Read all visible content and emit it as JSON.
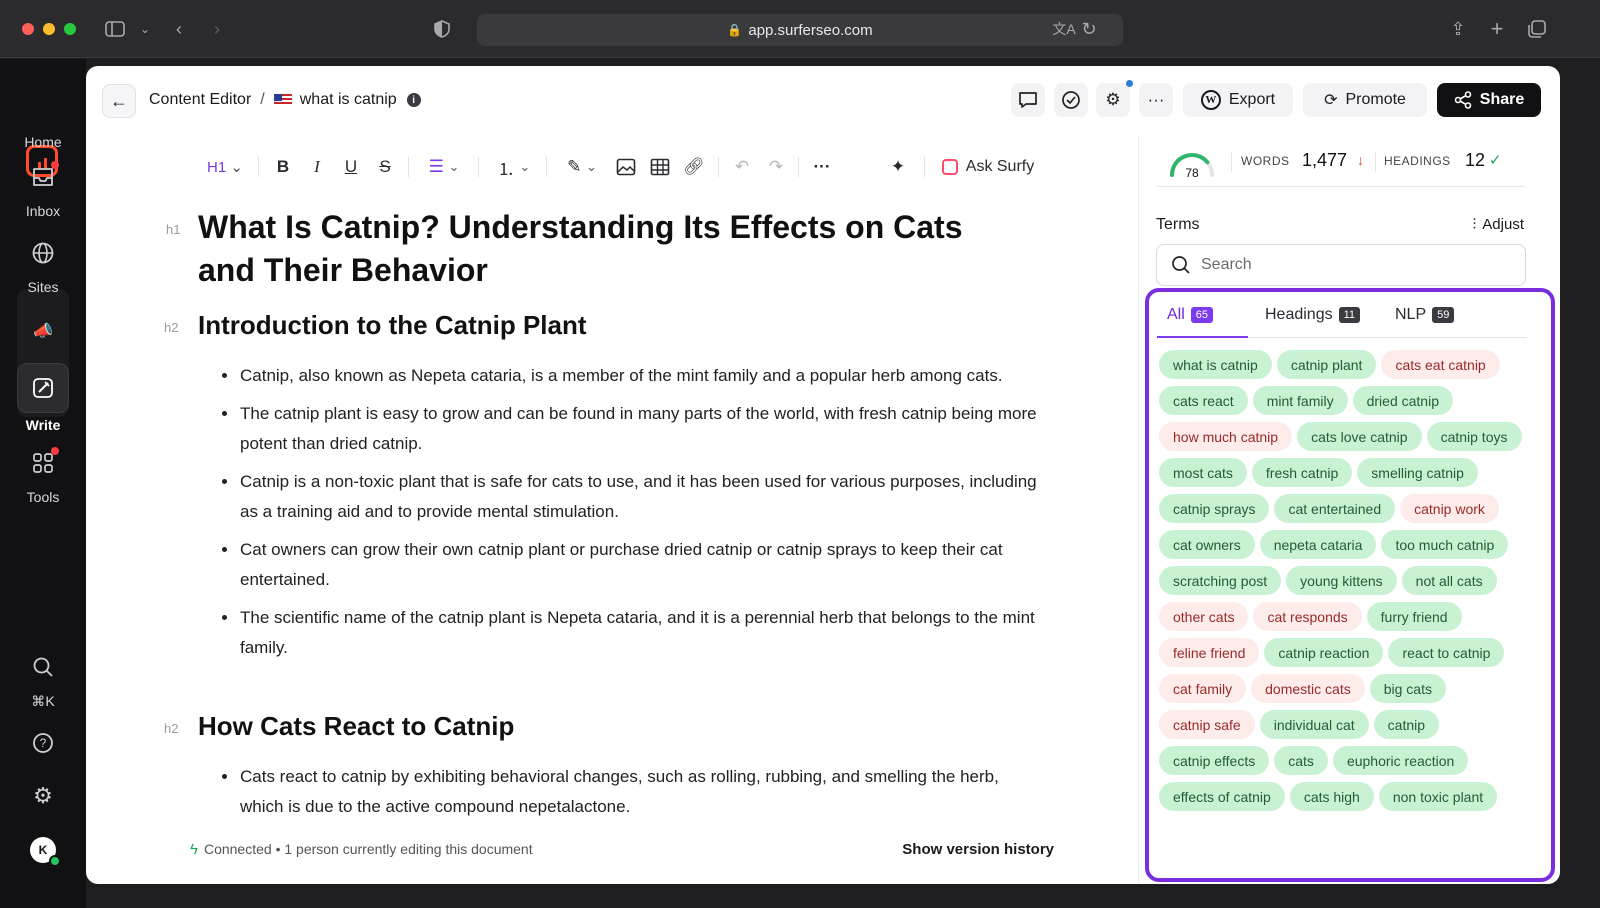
{
  "browser": {
    "url": "app.surferseo.com"
  },
  "sidebar": {
    "items": [
      {
        "label": "Home",
        "icon": "surfer-logo"
      },
      {
        "label": "Inbox",
        "icon": "inbox-icon"
      },
      {
        "label": "Sites",
        "icon": "globe-icon"
      },
      {
        "label": "Write",
        "icon": "write-icon"
      },
      {
        "label": "Tools",
        "icon": "grid-icon"
      }
    ],
    "shortcut": "⌘K",
    "avatar_initial": "K"
  },
  "header": {
    "breadcrumb_root": "Content Editor",
    "breadcrumb_sep": "/",
    "doc_title": "what is catnip",
    "export_label": "Export",
    "promote_label": "Promote",
    "share_label": "Share"
  },
  "toolbar": {
    "heading_label": "H1",
    "ask_label": "Ask Surfy"
  },
  "document": {
    "h1_tag": "h1",
    "h2_tag": "h2",
    "title": "What Is Catnip? Understanding Its Effects on Cats and Their Behavior",
    "section1": "Introduction to the Catnip Plant",
    "bullets1": [
      "Catnip, also known as Nepeta cataria, is a member of the mint family and a popular herb among cats.",
      "The catnip plant is easy to grow and can be found in many parts of the world, with fresh catnip being more potent than dried catnip.",
      "Catnip is a non-toxic plant that is safe for cats to use, and it has been used for various purposes, including as a training aid and to provide mental stimulation.",
      "Cat owners can grow their own catnip plant or purchase dried catnip or catnip sprays to keep their cat entertained.",
      "The scientific name of the catnip plant is Nepeta cataria, and it is a perennial herb that belongs to the mint family."
    ],
    "section2": "How Cats React to Catnip",
    "bullets2": [
      "Cats react to catnip by exhibiting behavioral changes, such as rolling, rubbing, and smelling the herb, which is due to the active compound nepetalactone."
    ]
  },
  "status": {
    "connected": "Connected",
    "editing": "• 1 person currently editing this document",
    "history": "Show version history"
  },
  "metrics": {
    "score": "78",
    "score_fraction": 0.78,
    "words_label": "WORDS",
    "words_value": "1,477",
    "words_trend": "↓",
    "headings_label": "HEADINGS",
    "headings_value": "12",
    "headings_status": "✓",
    "colors": {
      "down": "#e0433b",
      "ok": "#21a35a",
      "accent": "#7c3aed"
    }
  },
  "terms": {
    "title": "Terms",
    "adjust_label": "Adjust",
    "search_placeholder": "Search",
    "tabs": [
      {
        "label": "All",
        "count": "65"
      },
      {
        "label": "Headings",
        "count": "11"
      },
      {
        "label": "NLP",
        "count": "59"
      }
    ],
    "chips": [
      {
        "text": "what is catnip",
        "state": "g"
      },
      {
        "text": "catnip plant",
        "state": "g"
      },
      {
        "text": "cats eat catnip",
        "state": "r"
      },
      {
        "text": "cats react",
        "state": "g"
      },
      {
        "text": "mint family",
        "state": "g"
      },
      {
        "text": "dried catnip",
        "state": "g"
      },
      {
        "text": "how much catnip",
        "state": "r"
      },
      {
        "text": "cats love catnip",
        "state": "g"
      },
      {
        "text": "catnip toys",
        "state": "g"
      },
      {
        "text": "most cats",
        "state": "g"
      },
      {
        "text": "fresh catnip",
        "state": "g"
      },
      {
        "text": "smelling catnip",
        "state": "g"
      },
      {
        "text": "catnip sprays",
        "state": "g"
      },
      {
        "text": "cat entertained",
        "state": "g"
      },
      {
        "text": "catnip work",
        "state": "r"
      },
      {
        "text": "cat owners",
        "state": "g"
      },
      {
        "text": "nepeta cataria",
        "state": "g"
      },
      {
        "text": "too much catnip",
        "state": "g"
      },
      {
        "text": "scratching post",
        "state": "g"
      },
      {
        "text": "young kittens",
        "state": "g"
      },
      {
        "text": "not all cats",
        "state": "g"
      },
      {
        "text": "other cats",
        "state": "r"
      },
      {
        "text": "cat responds",
        "state": "r"
      },
      {
        "text": "furry friend",
        "state": "g"
      },
      {
        "text": "feline friend",
        "state": "r"
      },
      {
        "text": "catnip reaction",
        "state": "g"
      },
      {
        "text": "react to catnip",
        "state": "g"
      },
      {
        "text": "cat family",
        "state": "r"
      },
      {
        "text": "domestic cats",
        "state": "r"
      },
      {
        "text": "big cats",
        "state": "g"
      },
      {
        "text": "catnip safe",
        "state": "r"
      },
      {
        "text": "individual cat",
        "state": "g"
      },
      {
        "text": "catnip",
        "state": "g"
      },
      {
        "text": "catnip effects",
        "state": "g"
      },
      {
        "text": "cats",
        "state": "g"
      },
      {
        "text": "euphoric reaction",
        "state": "g"
      },
      {
        "text": "effects of catnip",
        "state": "g"
      },
      {
        "text": "cats high",
        "state": "g"
      },
      {
        "text": "non toxic plant",
        "state": "g"
      }
    ]
  }
}
